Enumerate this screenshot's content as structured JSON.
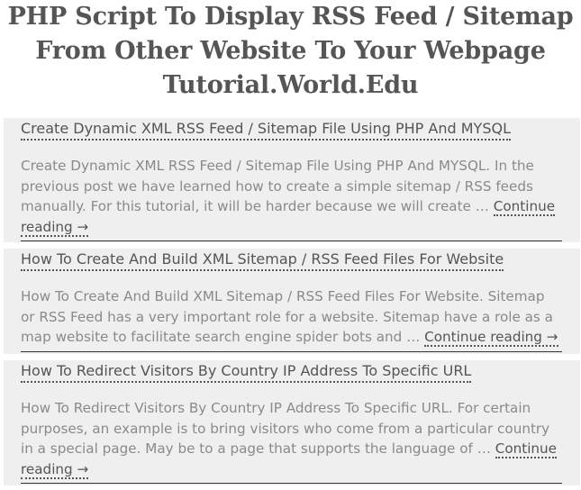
{
  "page": {
    "title_lines": [
      "PHP Script To Display RSS Feed / Sitemap",
      "From Other Website To Your Webpage",
      "Tutorial.World.Edu"
    ]
  },
  "feed": {
    "continue_label": "Continue reading →",
    "ellipsis": "…",
    "items": [
      {
        "title": "Create Dynamic XML RSS Feed / Sitemap File Using PHP And MYSQL",
        "excerpt": "Create Dynamic XML RSS Feed / Sitemap File Using PHP And MYSQL. In the previous post we have learned how to create a simple sitemap / RSS feeds manually. For this tutorial, it will be harder because we will create"
      },
      {
        "title": "How To Create And Build XML Sitemap / RSS Feed Files For Website",
        "excerpt": "How To Create And Build XML Sitemap / RSS Feed Files For Website. Sitemap or RSS Feed has a very important role for a website. Sitemap have a role as a map website to facilitate search engine spider bots and"
      },
      {
        "title": "How To Redirect Visitors By Country IP Address To Specific URL",
        "excerpt": "How To Redirect Visitors By Country IP Address To Specific URL. For certain purposes, an example is to bring visitors who come from a particular country in a special page. May be to a page that supports the language of"
      }
    ]
  }
}
